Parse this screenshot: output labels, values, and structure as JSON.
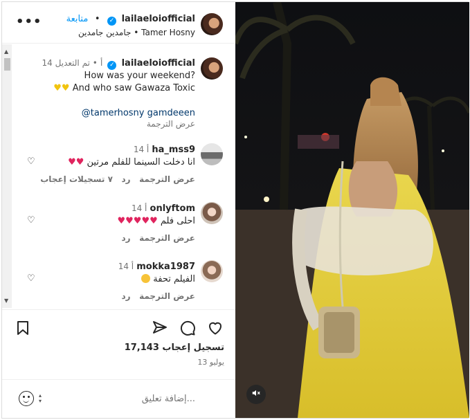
{
  "header": {
    "username": "lailaeloiofficial",
    "follow_label": "متابعة",
    "separator": "•",
    "subtitle_song": "جامدين جامدين",
    "subtitle_artist": "Tamer Hosny",
    "more_icon": "more-horizontal-icon"
  },
  "caption": {
    "username": "lailaeloiofficial",
    "edited": "تم التعديل",
    "time": "14 أ",
    "line1": "How was your weekend?",
    "line2": "And who saw Gawaza Toxic",
    "mentions": "@tamerhosny gamdeeen",
    "translate": "عرض الترجمة"
  },
  "comments": [
    {
      "username": "ha_mss9",
      "time": "14 أ",
      "text": "انا دخلت السينما للفلم مرتين",
      "likes": "٧ تسجيلات إعجاب",
      "reply": "رد",
      "translate": "عرض الترجمة"
    },
    {
      "username": "onlyftom",
      "time": "14 أ",
      "text": "احلى فلم",
      "reply": "رد",
      "translate": "عرض الترجمة"
    },
    {
      "username": "mokka1987",
      "time": "14 أ",
      "text": "الفيلم تحفة",
      "reply": "رد",
      "translate": "عرض الترجمة"
    }
  ],
  "actions": {
    "likes_count": "17,143",
    "likes_label": "تسجيل إعجاب",
    "date": "13 يوليو",
    "comment_placeholder": "إضافة تعليق..."
  },
  "colors": {
    "accent": "#0095f6",
    "heart": "#e0245e",
    "dress": "#e8d24a"
  }
}
